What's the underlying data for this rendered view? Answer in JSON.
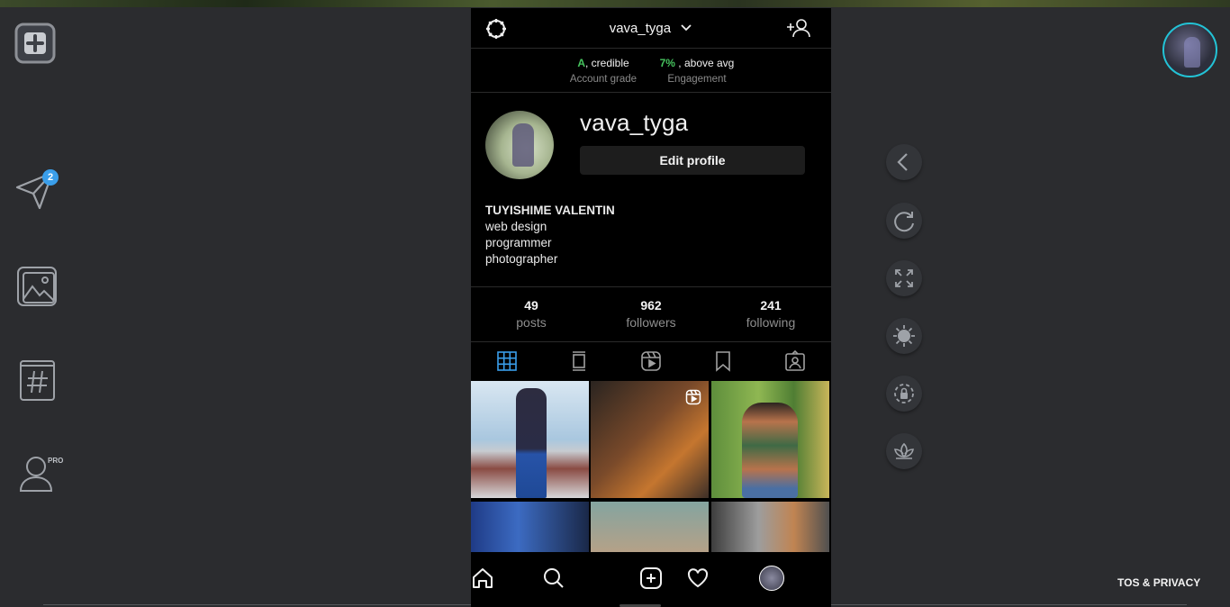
{
  "header": {
    "username": "vava_tyga"
  },
  "grade": {
    "account_value": "A",
    "account_text": ", credible",
    "account_label": "Account grade",
    "engagement_value": "7%",
    "engagement_text": " , above avg",
    "engagement_label": "Engagement"
  },
  "profile": {
    "username": "vava_tyga",
    "edit_label": "Edit profile",
    "full_name": "TUYISHIME VALENTIN",
    "bio": [
      "web design",
      "programmer",
      "photographer"
    ]
  },
  "counts": [
    {
      "number": "49",
      "label": "posts"
    },
    {
      "number": "962",
      "label": "followers"
    },
    {
      "number": "241",
      "label": "following"
    }
  ],
  "sidebar": {
    "messages_badge": "2",
    "pro_label": "PRO"
  },
  "footer": {
    "tos": "TOS & PRIVACY"
  },
  "colors": {
    "accent": "#3a9eea",
    "grade_green": "#46c35e",
    "avatar_ring": "#23c3d6"
  }
}
